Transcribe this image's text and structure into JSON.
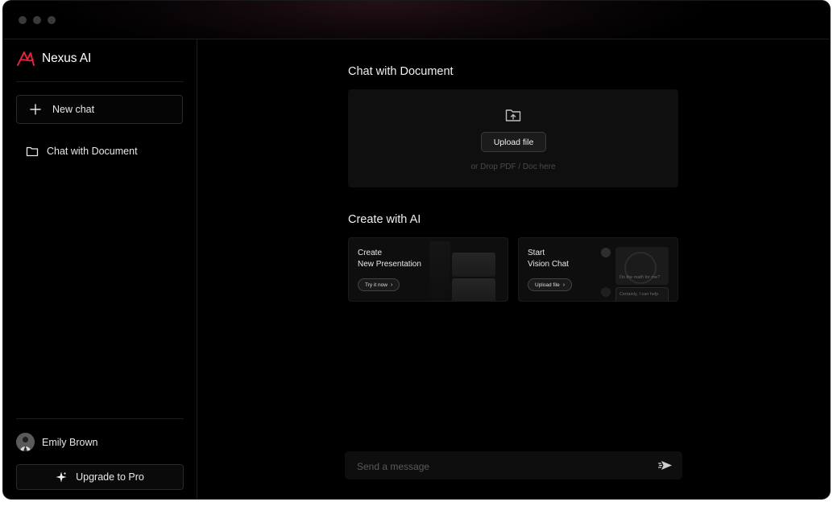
{
  "app": {
    "name": "Nexus AI",
    "brand_color": "#e0243c"
  },
  "sidebar": {
    "new_chat_label": "New chat",
    "items": [
      {
        "label": "Chat with Document",
        "icon": "folder-icon"
      }
    ],
    "user": {
      "name": "Emily Brown"
    },
    "upgrade_label": "Upgrade to Pro"
  },
  "main": {
    "document_section": {
      "title": "Chat with Document",
      "upload_button": "Upload file",
      "drop_hint": "or Drop PDF / Doc here"
    },
    "create_section": {
      "title": "Create with AI",
      "cards": [
        {
          "line1": "Create",
          "line2": "New Presentation",
          "button": "Try it now"
        },
        {
          "line1": "Start",
          "line2": "Vision Chat",
          "button": "Upload file",
          "preview_question": "Do the math for me?",
          "preview_answer": "Certainly, I can help"
        }
      ]
    },
    "composer": {
      "placeholder": "Send a message"
    }
  }
}
